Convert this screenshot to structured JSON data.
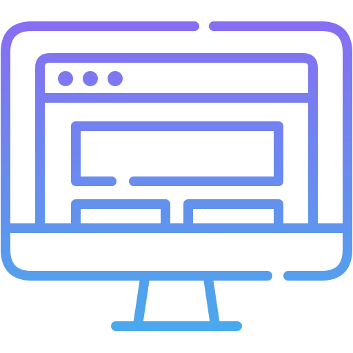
{
  "icon": {
    "name": "desktop-website-icon",
    "gradient": {
      "top": "#8a6cf2",
      "bottom": "#4aa9ec"
    },
    "window_dots": 3
  }
}
